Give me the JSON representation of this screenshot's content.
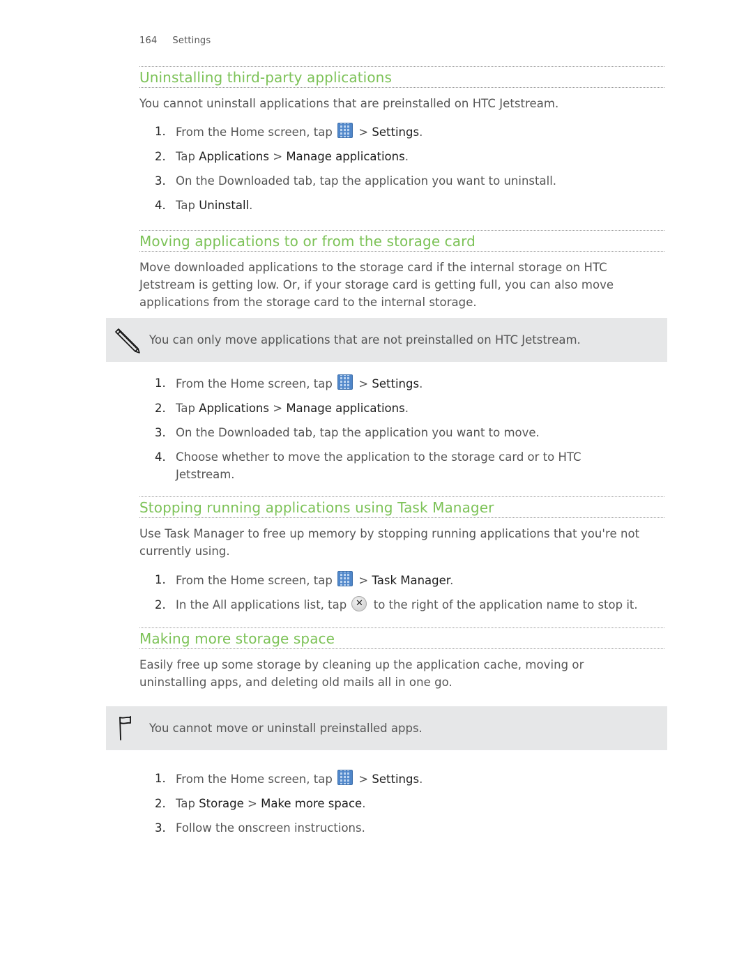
{
  "header": {
    "page_number": "164",
    "chapter": "Settings"
  },
  "sections": [
    {
      "title": "Uninstalling third-party applications",
      "intro": "You cannot uninstall applications that are preinstalled on HTC Jetstream.",
      "steps": [
        {
          "num": "1.",
          "pre": "From the Home screen, tap",
          "icon": "apps-grid-icon",
          "post_sep": " > ",
          "term": "Settings",
          "end": "."
        },
        {
          "num": "2.",
          "pre": "Tap ",
          "term1": "Applications",
          "sep": " > ",
          "term2": "Manage applications",
          "end": "."
        },
        {
          "num": "3.",
          "text": "On the Downloaded tab, tap the application you want to uninstall."
        },
        {
          "num": "4.",
          "pre": "Tap ",
          "term": "Uninstall",
          "end": "."
        }
      ]
    },
    {
      "title": "Moving applications to or from the storage card",
      "intro": "Move downloaded applications to the storage card if the internal storage on HTC Jetstream is getting low. Or, if your storage card is getting full, you can also move applications from the storage card to the internal storage.",
      "note": {
        "icon": "pencil-icon",
        "text": "You can only move applications that are not preinstalled on HTC Jetstream."
      },
      "steps": [
        {
          "num": "1.",
          "pre": "From the Home screen, tap",
          "icon": "apps-grid-icon",
          "post_sep": " > ",
          "term": "Settings",
          "end": "."
        },
        {
          "num": "2.",
          "pre": "Tap ",
          "term1": "Applications",
          "sep": " > ",
          "term2": "Manage applications",
          "end": "."
        },
        {
          "num": "3.",
          "text": "On the Downloaded tab, tap the application you want to move."
        },
        {
          "num": "4.",
          "text": "Choose whether to move the application to the storage card or to HTC Jetstream."
        }
      ]
    },
    {
      "title": "Stopping running applications using Task Manager",
      "intro": "Use Task Manager to free up memory by stopping running applications that you're not currently using.",
      "steps": [
        {
          "num": "1.",
          "pre": "From the Home screen, tap",
          "icon": "apps-grid-icon",
          "post_sep": " > ",
          "term": "Task Manager",
          "end": "."
        },
        {
          "num": "2.",
          "pre": "In the All applications list, tap",
          "icon": "close-circle-icon",
          "post": " to the right of the application name to stop it."
        }
      ]
    },
    {
      "title": "Making more storage space",
      "intro": "Easily free up some storage by cleaning up the application cache, moving or uninstalling apps, and deleting old mails all in one go.",
      "note": {
        "icon": "flag-icon",
        "text": "You cannot move or uninstall preinstalled apps."
      },
      "steps": [
        {
          "num": "1.",
          "pre": "From the Home screen, tap",
          "icon": "apps-grid-icon",
          "post_sep": " > ",
          "term": "Settings",
          "end": "."
        },
        {
          "num": "2.",
          "pre": "Tap ",
          "term1": "Storage",
          "sep": " > ",
          "term2": "Make more space",
          "end": "."
        },
        {
          "num": "3.",
          "text": "Follow the onscreen instructions."
        }
      ]
    }
  ]
}
